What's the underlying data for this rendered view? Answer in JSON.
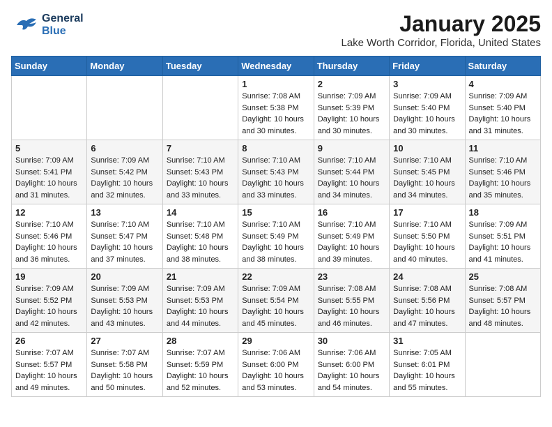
{
  "header": {
    "logo_general": "General",
    "logo_blue": "Blue",
    "month_title": "January 2025",
    "location": "Lake Worth Corridor, Florida, United States"
  },
  "calendar": {
    "days_of_week": [
      "Sunday",
      "Monday",
      "Tuesday",
      "Wednesday",
      "Thursday",
      "Friday",
      "Saturday"
    ],
    "weeks": [
      [
        {
          "day": "",
          "info": ""
        },
        {
          "day": "",
          "info": ""
        },
        {
          "day": "",
          "info": ""
        },
        {
          "day": "1",
          "info": "Sunrise: 7:08 AM\nSunset: 5:38 PM\nDaylight: 10 hours\nand 30 minutes."
        },
        {
          "day": "2",
          "info": "Sunrise: 7:09 AM\nSunset: 5:39 PM\nDaylight: 10 hours\nand 30 minutes."
        },
        {
          "day": "3",
          "info": "Sunrise: 7:09 AM\nSunset: 5:40 PM\nDaylight: 10 hours\nand 30 minutes."
        },
        {
          "day": "4",
          "info": "Sunrise: 7:09 AM\nSunset: 5:40 PM\nDaylight: 10 hours\nand 31 minutes."
        }
      ],
      [
        {
          "day": "5",
          "info": "Sunrise: 7:09 AM\nSunset: 5:41 PM\nDaylight: 10 hours\nand 31 minutes."
        },
        {
          "day": "6",
          "info": "Sunrise: 7:09 AM\nSunset: 5:42 PM\nDaylight: 10 hours\nand 32 minutes."
        },
        {
          "day": "7",
          "info": "Sunrise: 7:10 AM\nSunset: 5:43 PM\nDaylight: 10 hours\nand 33 minutes."
        },
        {
          "day": "8",
          "info": "Sunrise: 7:10 AM\nSunset: 5:43 PM\nDaylight: 10 hours\nand 33 minutes."
        },
        {
          "day": "9",
          "info": "Sunrise: 7:10 AM\nSunset: 5:44 PM\nDaylight: 10 hours\nand 34 minutes."
        },
        {
          "day": "10",
          "info": "Sunrise: 7:10 AM\nSunset: 5:45 PM\nDaylight: 10 hours\nand 34 minutes."
        },
        {
          "day": "11",
          "info": "Sunrise: 7:10 AM\nSunset: 5:46 PM\nDaylight: 10 hours\nand 35 minutes."
        }
      ],
      [
        {
          "day": "12",
          "info": "Sunrise: 7:10 AM\nSunset: 5:46 PM\nDaylight: 10 hours\nand 36 minutes."
        },
        {
          "day": "13",
          "info": "Sunrise: 7:10 AM\nSunset: 5:47 PM\nDaylight: 10 hours\nand 37 minutes."
        },
        {
          "day": "14",
          "info": "Sunrise: 7:10 AM\nSunset: 5:48 PM\nDaylight: 10 hours\nand 38 minutes."
        },
        {
          "day": "15",
          "info": "Sunrise: 7:10 AM\nSunset: 5:49 PM\nDaylight: 10 hours\nand 38 minutes."
        },
        {
          "day": "16",
          "info": "Sunrise: 7:10 AM\nSunset: 5:49 PM\nDaylight: 10 hours\nand 39 minutes."
        },
        {
          "day": "17",
          "info": "Sunrise: 7:10 AM\nSunset: 5:50 PM\nDaylight: 10 hours\nand 40 minutes."
        },
        {
          "day": "18",
          "info": "Sunrise: 7:09 AM\nSunset: 5:51 PM\nDaylight: 10 hours\nand 41 minutes."
        }
      ],
      [
        {
          "day": "19",
          "info": "Sunrise: 7:09 AM\nSunset: 5:52 PM\nDaylight: 10 hours\nand 42 minutes."
        },
        {
          "day": "20",
          "info": "Sunrise: 7:09 AM\nSunset: 5:53 PM\nDaylight: 10 hours\nand 43 minutes."
        },
        {
          "day": "21",
          "info": "Sunrise: 7:09 AM\nSunset: 5:53 PM\nDaylight: 10 hours\nand 44 minutes."
        },
        {
          "day": "22",
          "info": "Sunrise: 7:09 AM\nSunset: 5:54 PM\nDaylight: 10 hours\nand 45 minutes."
        },
        {
          "day": "23",
          "info": "Sunrise: 7:08 AM\nSunset: 5:55 PM\nDaylight: 10 hours\nand 46 minutes."
        },
        {
          "day": "24",
          "info": "Sunrise: 7:08 AM\nSunset: 5:56 PM\nDaylight: 10 hours\nand 47 minutes."
        },
        {
          "day": "25",
          "info": "Sunrise: 7:08 AM\nSunset: 5:57 PM\nDaylight: 10 hours\nand 48 minutes."
        }
      ],
      [
        {
          "day": "26",
          "info": "Sunrise: 7:07 AM\nSunset: 5:57 PM\nDaylight: 10 hours\nand 49 minutes."
        },
        {
          "day": "27",
          "info": "Sunrise: 7:07 AM\nSunset: 5:58 PM\nDaylight: 10 hours\nand 50 minutes."
        },
        {
          "day": "28",
          "info": "Sunrise: 7:07 AM\nSunset: 5:59 PM\nDaylight: 10 hours\nand 52 minutes."
        },
        {
          "day": "29",
          "info": "Sunrise: 7:06 AM\nSunset: 6:00 PM\nDaylight: 10 hours\nand 53 minutes."
        },
        {
          "day": "30",
          "info": "Sunrise: 7:06 AM\nSunset: 6:00 PM\nDaylight: 10 hours\nand 54 minutes."
        },
        {
          "day": "31",
          "info": "Sunrise: 7:05 AM\nSunset: 6:01 PM\nDaylight: 10 hours\nand 55 minutes."
        },
        {
          "day": "",
          "info": ""
        }
      ]
    ]
  }
}
